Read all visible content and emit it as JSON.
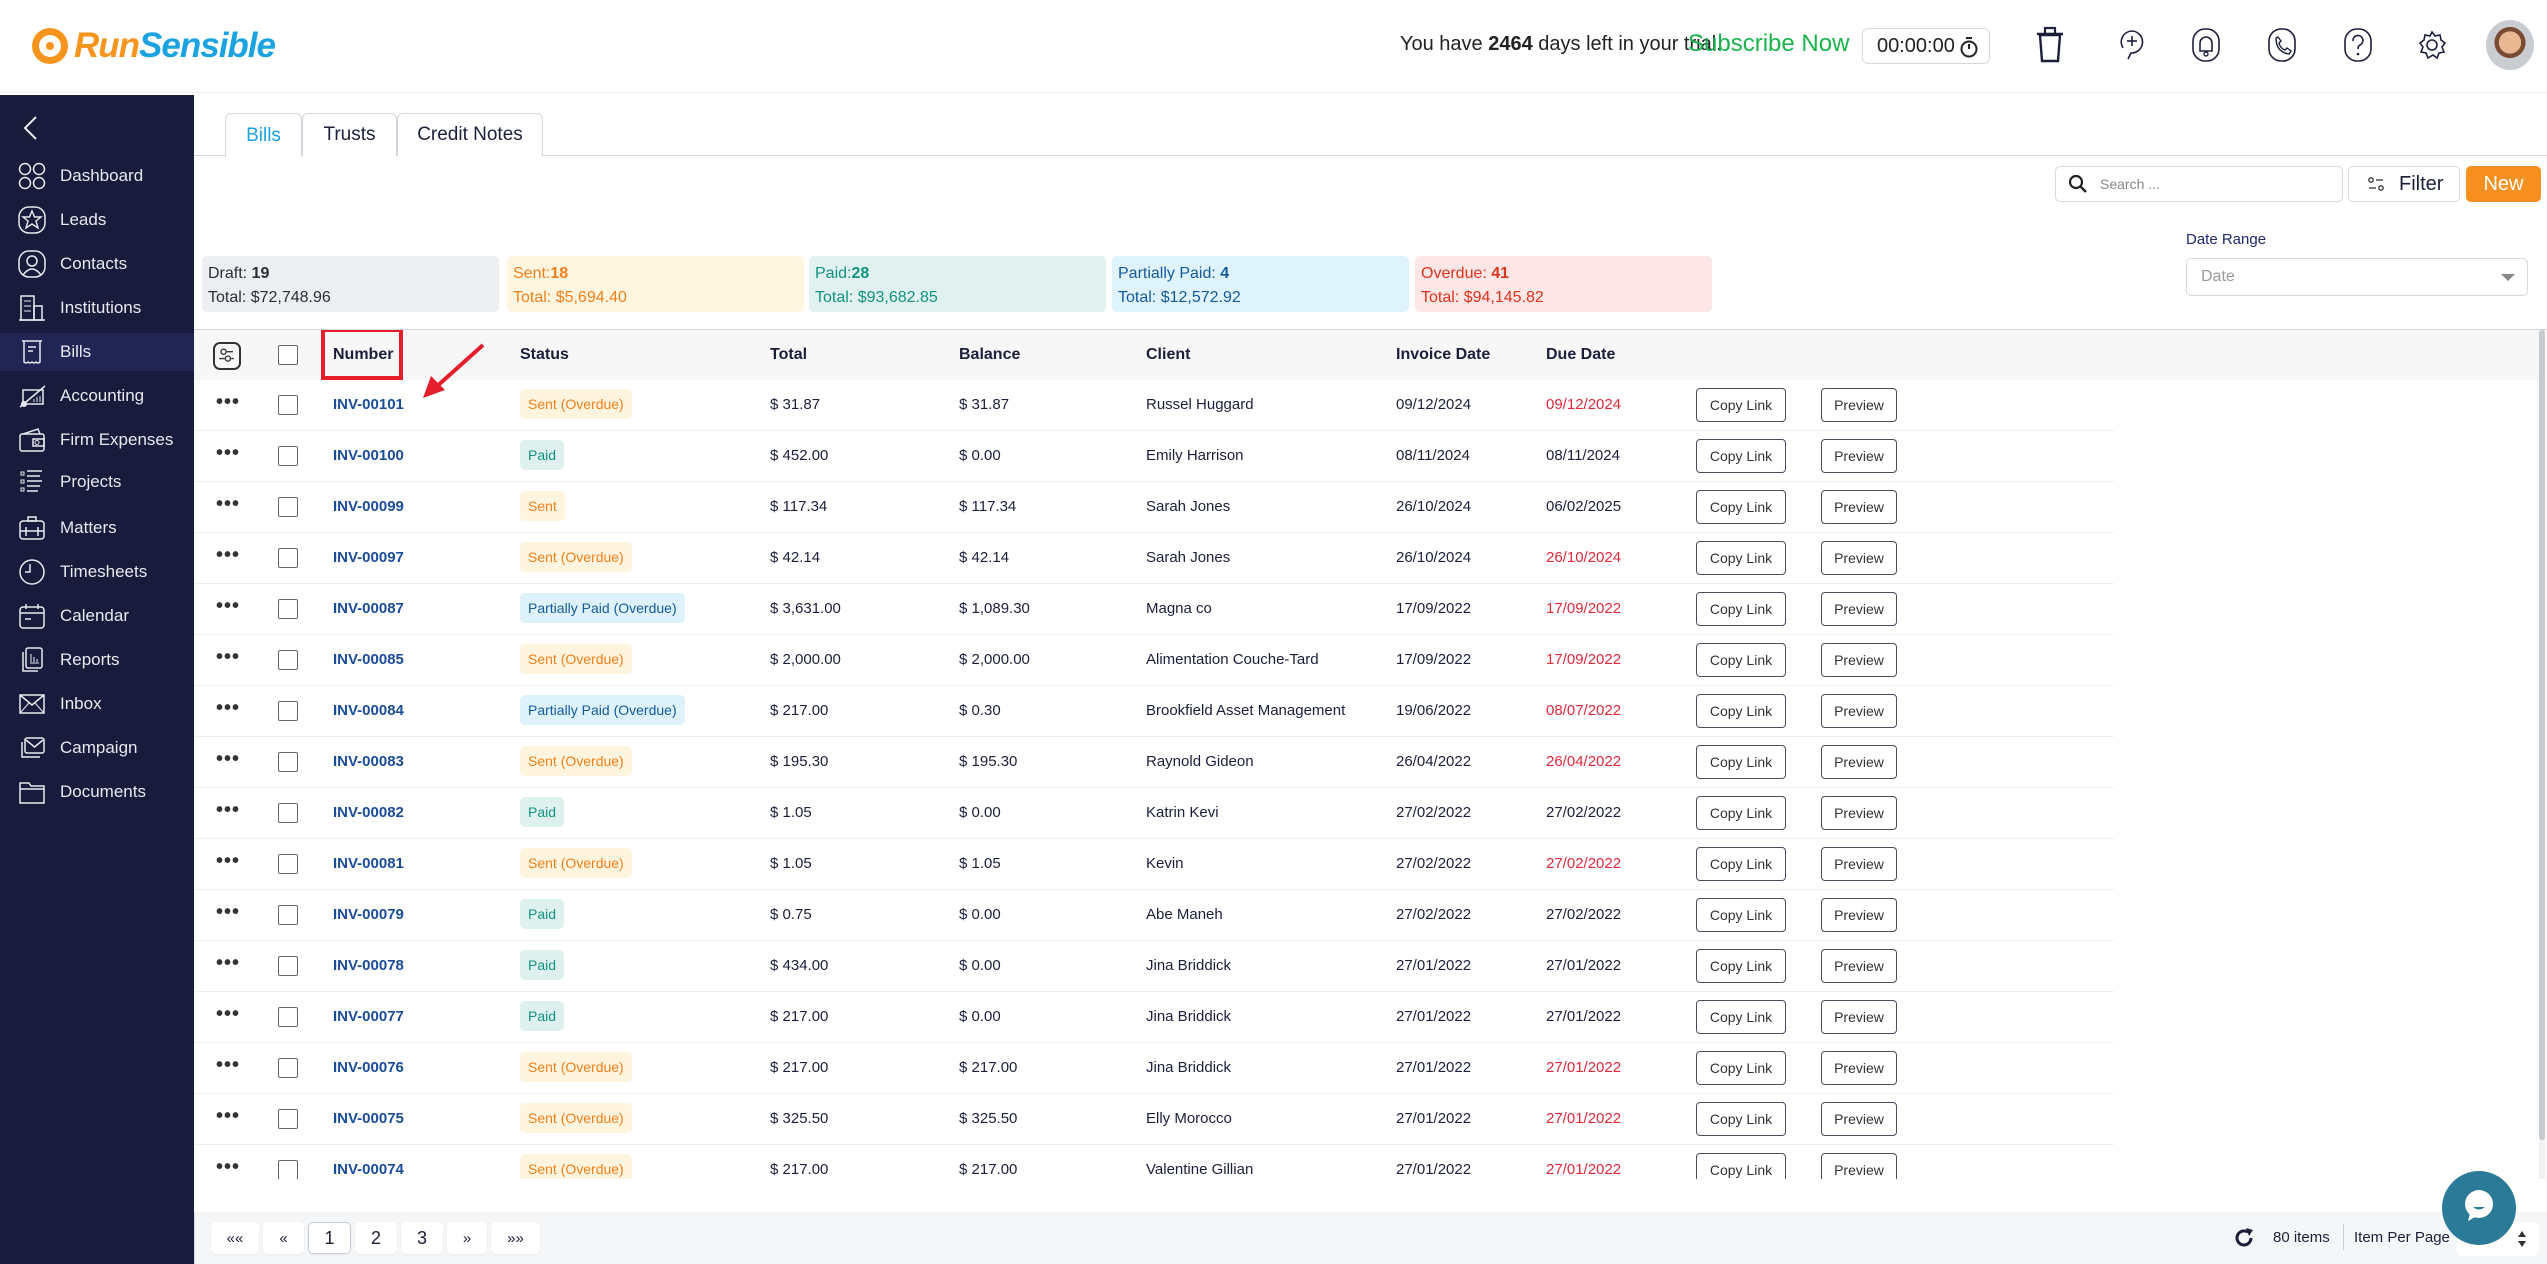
{
  "header": {
    "brand_part1": "Run",
    "brand_part2": "Sensible",
    "trial_prefix": "You have ",
    "trial_days": "2464",
    "trial_suffix": " days left in your trial.",
    "subscribe_label": "Subscribe Now",
    "timer_value": "00:00:00",
    "icons": [
      "trash-icon",
      "add-task-icon",
      "notification-bell-icon",
      "phone-icon",
      "help-icon",
      "settings-gear-icon",
      "user-avatar"
    ]
  },
  "sidebar": {
    "items": [
      {
        "label": "Dashboard",
        "icon": "dashboard-icon"
      },
      {
        "label": "Leads",
        "icon": "star-icon"
      },
      {
        "label": "Contacts",
        "icon": "contact-icon"
      },
      {
        "label": "Institutions",
        "icon": "building-icon"
      },
      {
        "label": "Bills",
        "icon": "receipt-icon",
        "active": true
      },
      {
        "label": "Accounting",
        "icon": "chart-icon"
      },
      {
        "label": "Firm Expenses",
        "icon": "wallet-icon"
      },
      {
        "label": "Projects",
        "icon": "list-icon"
      },
      {
        "label": "Matters",
        "icon": "briefcase-icon"
      },
      {
        "label": "Timesheets",
        "icon": "clock-icon"
      },
      {
        "label": "Calendar",
        "icon": "calendar-icon"
      },
      {
        "label": "Reports",
        "icon": "reports-icon"
      },
      {
        "label": "Inbox",
        "icon": "envelope-icon"
      },
      {
        "label": "Campaign",
        "icon": "campaign-icon"
      },
      {
        "label": "Documents",
        "icon": "folder-icon"
      }
    ]
  },
  "tabs": [
    {
      "label": "Bills",
      "active": true
    },
    {
      "label": "Trusts"
    },
    {
      "label": "Credit Notes"
    }
  ],
  "toolbar": {
    "search_placeholder": "Search ...",
    "filter_label": "Filter",
    "new_label": "New",
    "date_range_label": "Date Range",
    "date_placeholder": "Date"
  },
  "summary": [
    {
      "label": "Draft: ",
      "count": "19",
      "total": "Total: $72,748.96",
      "bg": "#eceef1",
      "fg": "#2b2e3a"
    },
    {
      "label": "Sent:",
      "count": "18",
      "total": "Total: $5,694.40",
      "bg": "#fff6e0",
      "fg": "#f2801c"
    },
    {
      "label": "Paid:",
      "count": "28",
      "total": "Total: $93,682.85",
      "bg": "#e0f1ef",
      "fg": "#12937f"
    },
    {
      "label": "Partially Paid: ",
      "count": "4",
      "total": "Total: $12,572.92",
      "bg": "#dff3fc",
      "fg": "#155b9c"
    },
    {
      "label": "Overdue: ",
      "count": "41",
      "total": "Total: $94,145.82",
      "bg": "#fde6e6",
      "fg": "#e0341e"
    }
  ],
  "table": {
    "columns": [
      "Number",
      "Status",
      "Total",
      "Balance",
      "Client",
      "Invoice Date",
      "Due Date"
    ],
    "copy_link_label": "Copy Link",
    "preview_label": "Preview",
    "rows": [
      {
        "number": "INV-00101",
        "status": "Sent (Overdue)",
        "status_type": "sent",
        "total": "$ 31.87",
        "balance": "$ 31.87",
        "client": "Russel Huggard",
        "invoice_date": "09/12/2024",
        "due_date": "09/12/2024",
        "overdue": true
      },
      {
        "number": "INV-00100",
        "status": "Paid",
        "status_type": "paid",
        "total": "$ 452.00",
        "balance": "$ 0.00",
        "client": "Emily Harrison",
        "invoice_date": "08/11/2024",
        "due_date": "08/11/2024",
        "overdue": false
      },
      {
        "number": "INV-00099",
        "status": "Sent",
        "status_type": "sent",
        "total": "$ 117.34",
        "balance": "$ 117.34",
        "client": "Sarah Jones",
        "invoice_date": "26/10/2024",
        "due_date": "06/02/2025",
        "overdue": false
      },
      {
        "number": "INV-00097",
        "status": "Sent (Overdue)",
        "status_type": "sent",
        "total": "$ 42.14",
        "balance": "$ 42.14",
        "client": "Sarah Jones",
        "invoice_date": "26/10/2024",
        "due_date": "26/10/2024",
        "overdue": true
      },
      {
        "number": "INV-00087",
        "status": "Partially Paid (Overdue)",
        "status_type": "partial",
        "total": "$ 3,631.00",
        "balance": "$ 1,089.30",
        "client": "Magna co",
        "invoice_date": "17/09/2022",
        "due_date": "17/09/2022",
        "overdue": true
      },
      {
        "number": "INV-00085",
        "status": "Sent (Overdue)",
        "status_type": "sent",
        "total": "$ 2,000.00",
        "balance": "$ 2,000.00",
        "client": "Alimentation Couche-Tard",
        "invoice_date": "17/09/2022",
        "due_date": "17/09/2022",
        "overdue": true
      },
      {
        "number": "INV-00084",
        "status": "Partially Paid (Overdue)",
        "status_type": "partial",
        "total": "$ 217.00",
        "balance": "$ 0.30",
        "client": "Brookfield Asset Management",
        "invoice_date": "19/06/2022",
        "due_date": "08/07/2022",
        "overdue": true
      },
      {
        "number": "INV-00083",
        "status": "Sent (Overdue)",
        "status_type": "sent",
        "total": "$ 195.30",
        "balance": "$ 195.30",
        "client": "Raynold Gideon",
        "invoice_date": "26/04/2022",
        "due_date": "26/04/2022",
        "overdue": true
      },
      {
        "number": "INV-00082",
        "status": "Paid",
        "status_type": "paid",
        "total": "$ 1.05",
        "balance": "$ 0.00",
        "client": "Katrin Kevi",
        "invoice_date": "27/02/2022",
        "due_date": "27/02/2022",
        "overdue": false
      },
      {
        "number": "INV-00081",
        "status": "Sent (Overdue)",
        "status_type": "sent",
        "total": "$ 1.05",
        "balance": "$ 1.05",
        "client": "Kevin",
        "invoice_date": "27/02/2022",
        "due_date": "27/02/2022",
        "overdue": true
      },
      {
        "number": "INV-00079",
        "status": "Paid",
        "status_type": "paid",
        "total": "$ 0.75",
        "balance": "$ 0.00",
        "client": "Abe Maneh",
        "invoice_date": "27/02/2022",
        "due_date": "27/02/2022",
        "overdue": false
      },
      {
        "number": "INV-00078",
        "status": "Paid",
        "status_type": "paid",
        "total": "$ 434.00",
        "balance": "$ 0.00",
        "client": "Jina Briddick",
        "invoice_date": "27/01/2022",
        "due_date": "27/01/2022",
        "overdue": false
      },
      {
        "number": "INV-00077",
        "status": "Paid",
        "status_type": "paid",
        "total": "$ 217.00",
        "balance": "$ 0.00",
        "client": "Jina Briddick",
        "invoice_date": "27/01/2022",
        "due_date": "27/01/2022",
        "overdue": false
      },
      {
        "number": "INV-00076",
        "status": "Sent (Overdue)",
        "status_type": "sent",
        "total": "$ 217.00",
        "balance": "$ 217.00",
        "client": "Jina Briddick",
        "invoice_date": "27/01/2022",
        "due_date": "27/01/2022",
        "overdue": true
      },
      {
        "number": "INV-00075",
        "status": "Sent (Overdue)",
        "status_type": "sent",
        "total": "$ 325.50",
        "balance": "$ 325.50",
        "client": "Elly Morocco",
        "invoice_date": "27/01/2022",
        "due_date": "27/01/2022",
        "overdue": true
      },
      {
        "number": "INV-00074",
        "status": "Sent (Overdue)",
        "status_type": "sent",
        "total": "$ 217.00",
        "balance": "$ 217.00",
        "client": "Valentine Gillian",
        "invoice_date": "27/01/2022",
        "due_date": "27/01/2022",
        "overdue": true
      }
    ]
  },
  "pagination": {
    "first": "««",
    "prev": "«",
    "pages": [
      "1",
      "2",
      "3"
    ],
    "current_page": "1",
    "next": "»",
    "last": "»»",
    "items_count": "80 items",
    "item_per_page_label": "Item Per Page"
  },
  "colors": {
    "sidebar_bg": "#181b3b",
    "accent_orange": "#f7901e",
    "brand_blue": "#1aa3e0",
    "subscribe_green": "#1cb24e",
    "overdue_red": "#e0293b",
    "annotation_red": "#e41e2a"
  }
}
